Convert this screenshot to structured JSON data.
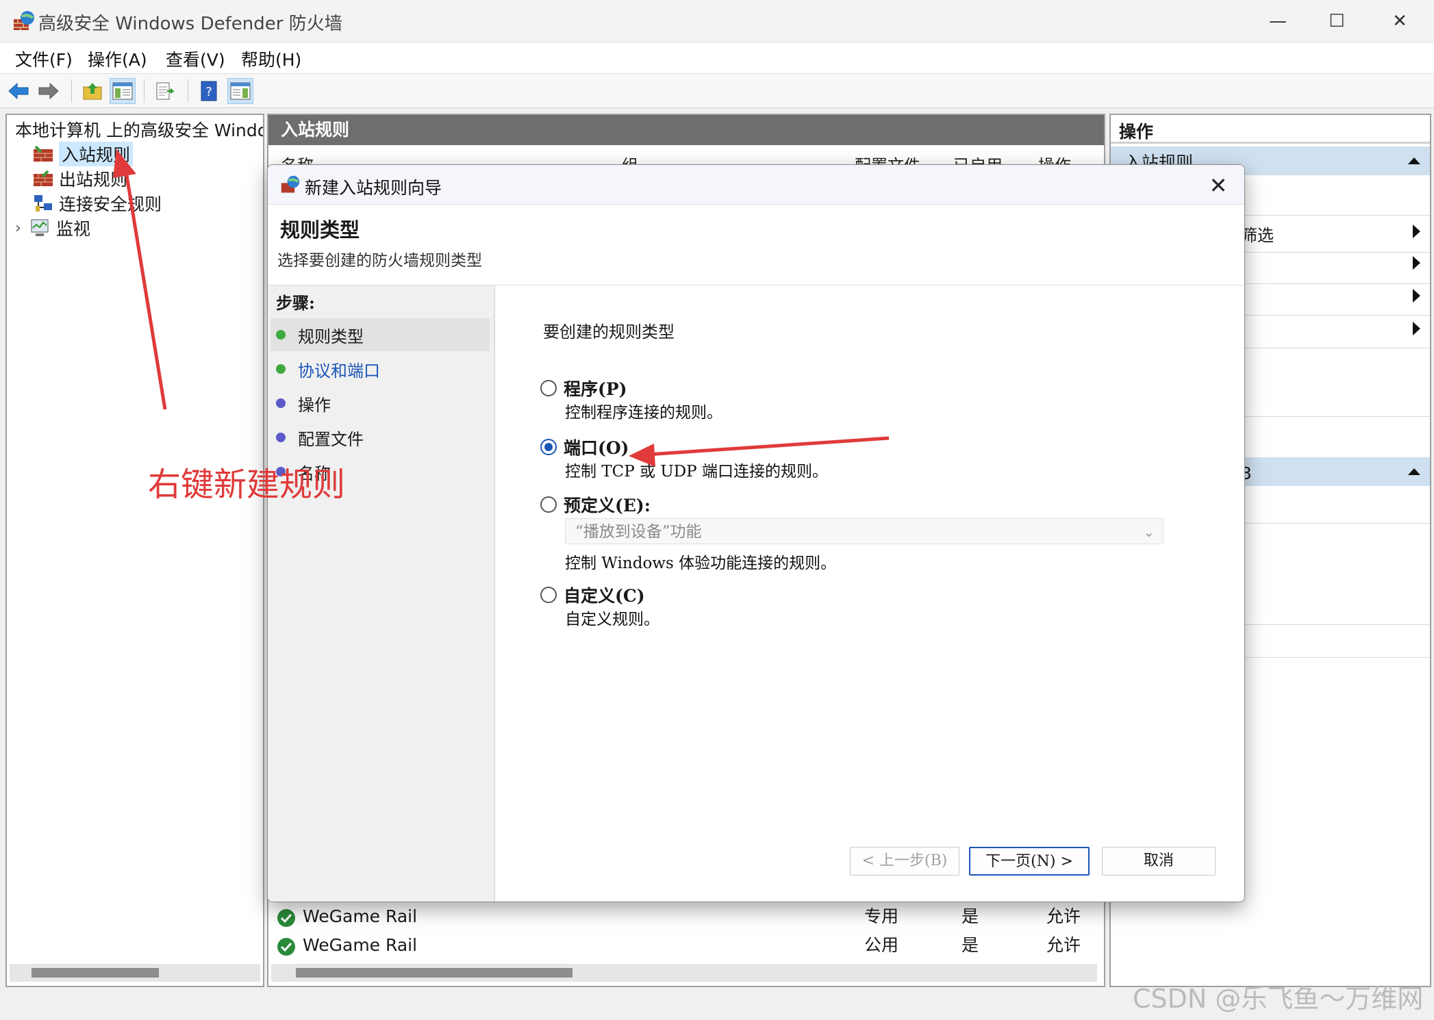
{
  "window": {
    "title": "高级安全 Windows Defender 防火墙",
    "minimize": "—",
    "maximize": "☐",
    "close": "✕"
  },
  "menu": [
    "文件(F)",
    "操作(A)",
    "查看(V)",
    "帮助(H)"
  ],
  "toolbar": {
    "icons": [
      "back-arrow-icon",
      "forward-arrow-icon",
      "up-folder-icon",
      "show-hide-tree-icon",
      "export-list-icon",
      "help-icon",
      "show-hide-action-pane-icon"
    ]
  },
  "tree": {
    "root": "本地计算机 上的高级安全 Windows Defender 防火墙",
    "items": [
      {
        "label": "入站规则",
        "selected": true
      },
      {
        "label": "出站规则"
      },
      {
        "label": "连接安全规则"
      },
      {
        "label": "监视",
        "expandable": true
      }
    ]
  },
  "center": {
    "title": "入站规则",
    "columns": [
      "名称",
      "组",
      "配置文件",
      "已启用",
      "操作"
    ],
    "rows": [
      {
        "name": "WeGame Rail",
        "profile": "专用",
        "enabled": "是",
        "action": "允许"
      },
      {
        "name": "WeGame Rail",
        "profile": "公用",
        "enabled": "是",
        "action": "允许"
      }
    ]
  },
  "right": {
    "title": "操作",
    "section1": "入站规则",
    "visible_item": "筛选",
    "section2_suffix": "3"
  },
  "dialog": {
    "title": "新建入站规则向导",
    "close": "✕",
    "heading": "规则类型",
    "subheading": "选择要创建的防火墙规则类型",
    "steps_title": "步骤:",
    "steps": [
      {
        "label": "规则类型",
        "state": "current",
        "dot": "#3fa83f"
      },
      {
        "label": "协议和端口",
        "state": "link",
        "dot": "#3fa83f"
      },
      {
        "label": "操作",
        "state": "pending",
        "dot": "#5a5ac8"
      },
      {
        "label": "配置文件",
        "state": "pending",
        "dot": "#5a5ac8"
      },
      {
        "label": "名称",
        "state": "pending",
        "dot": "#5a5ac8"
      }
    ],
    "prompt": "要创建的规则类型",
    "options": [
      {
        "label": "程序(P)",
        "desc": "控制程序连接的规则。",
        "selected": false
      },
      {
        "label": "端口(O)",
        "desc": "控制 TCP 或 UDP 端口连接的规则。",
        "selected": true
      },
      {
        "label": "预定义(E):",
        "desc": "控制 Windows 体验功能连接的规则。",
        "selected": false,
        "combo": "“播放到设备”功能"
      },
      {
        "label": "自定义(C)",
        "desc": "自定义规则。",
        "selected": false
      }
    ],
    "buttons": {
      "back": "< 上一步(B)",
      "next": "下一页(N) >",
      "cancel": "取消"
    }
  },
  "annotation": {
    "text": "右键新建规则",
    "color": "#e03a3a"
  },
  "watermark": "CSDN @乐飞鱼～万维网"
}
